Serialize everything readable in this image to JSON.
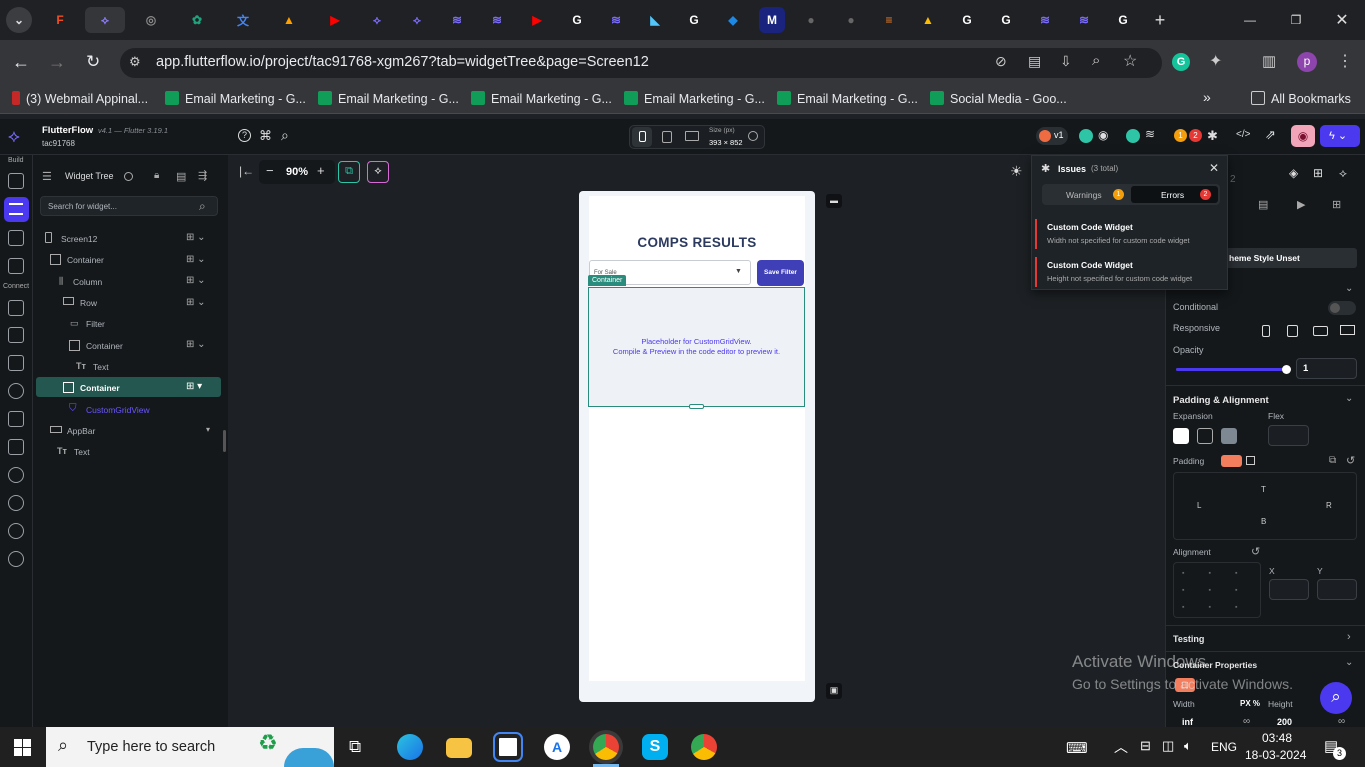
{
  "browser": {
    "url": "app.flutterflow.io/project/tac91768-xgm267?tab=widgetTree&page=Screen12",
    "bookmarks": [
      "(3) Webmail Appinal...",
      "Email Marketing - G...",
      "Email Marketing - G...",
      "Email Marketing - G...",
      "Email Marketing - G...",
      "Email Marketing - G...",
      "Social Media - Goo..."
    ],
    "all_bookmarks": "All Bookmarks",
    "profile_initial": "p",
    "colors": {
      "tabbar": "#202124",
      "toolbar": "#35363a"
    }
  },
  "app": {
    "name": "FlutterFlow",
    "version": "v4.1 — Flutter 3.19.1",
    "project": "tac91768",
    "zoom": "90%",
    "size_label": "Size (px)",
    "size_value": "393 × 852",
    "version_badge": "v1",
    "warn_count": "1",
    "err_count": "2",
    "accent": "#4b39ef"
  },
  "rail": {
    "build": "Build",
    "connect": "Connect"
  },
  "tree": {
    "title": "Widget Tree",
    "search_placeholder": "Search for widget...",
    "items": [
      {
        "label": "Screen12"
      },
      {
        "label": "Container"
      },
      {
        "label": "Column"
      },
      {
        "label": "Row"
      },
      {
        "label": "Filter"
      },
      {
        "label": "Container"
      },
      {
        "label": "Text"
      },
      {
        "label": "Container"
      },
      {
        "label": "CustomGridView"
      },
      {
        "label": "AppBar"
      },
      {
        "label": "Text"
      }
    ]
  },
  "phone": {
    "title": "COMPS RESULTS",
    "dropdown_text": "For Sale",
    "save_button": "Save Filter",
    "selection_tag": "Container",
    "placeholder_line1": "Placeholder for CustomGridView.",
    "placeholder_line2": "Compile & Preview in the code editor to preview it."
  },
  "issues": {
    "title": "Issues",
    "total": "(3 total)",
    "tab_warnings": "Warnings",
    "warnings_count": "1",
    "tab_errors": "Errors",
    "errors_count": "2",
    "items": [
      {
        "title": "Custom Code Widget",
        "desc": "Width not specified for custom code widget"
      },
      {
        "title": "Custom Code Widget",
        "desc": "Height not specified for custom code widget"
      }
    ]
  },
  "props": {
    "fragment_2": "2",
    "theme_style": "heme Style Unset",
    "conditional": "Conditional",
    "responsive": "Responsive",
    "opacity": "Opacity",
    "opacity_value": "1",
    "opacity_fraction": 1.0,
    "padding_alignment": "Padding & Alignment",
    "expansion": "Expansion",
    "flex": "Flex",
    "padding": "Padding",
    "pad_t": "T",
    "pad_l": "L",
    "pad_r": "R",
    "pad_b": "B",
    "alignment": "Alignment",
    "x": "X",
    "y": "Y",
    "testing": "Testing",
    "container_properties": "Container Properties",
    "width": "Width",
    "px_pct": "PX %",
    "height": "Height",
    "width_value": "inf",
    "height_value": "200",
    "infinity": "∞"
  },
  "watermark": {
    "line1": "Activate Windows",
    "line2": "Go to Settings to activate Windows."
  },
  "taskbar": {
    "search_placeholder": "Type here to search",
    "lang": "ENG",
    "time": "03:48",
    "date": "18-03-2024",
    "notif_count": "3"
  }
}
